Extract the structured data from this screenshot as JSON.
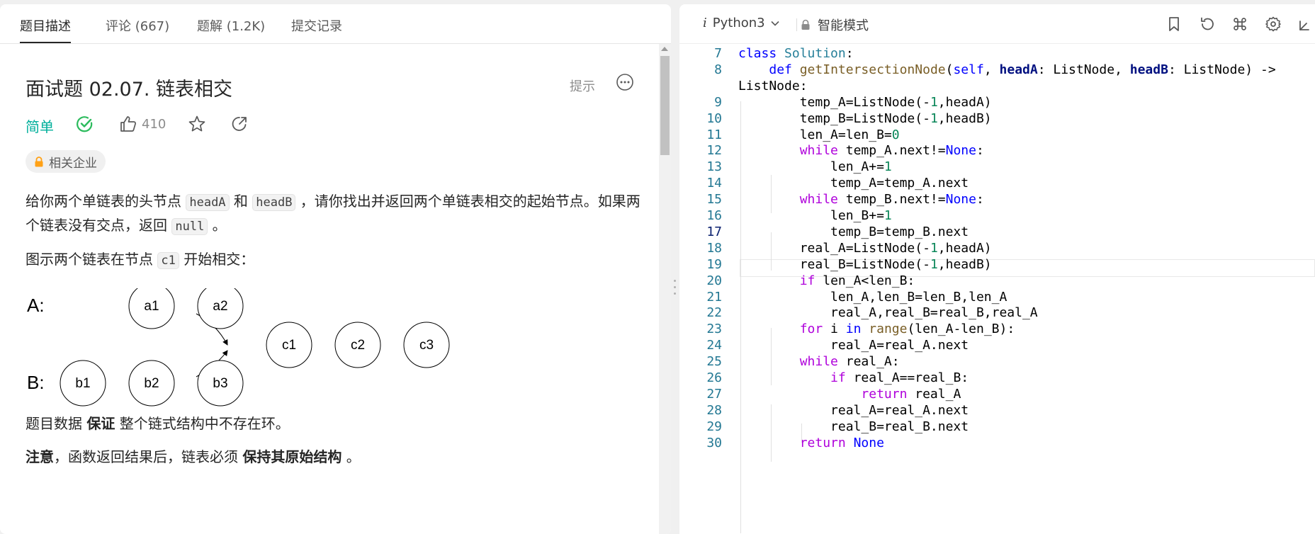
{
  "tabs": [
    {
      "label": "题目描述",
      "active": true
    },
    {
      "label": "评论 (667)"
    },
    {
      "label": "题解 (1.2K)"
    },
    {
      "label": "提交记录"
    }
  ],
  "problem": {
    "title": "面试题 02.07. 链表相交",
    "hint_label": "提示",
    "difficulty": "简单",
    "likes": "410",
    "company_tag": "相关企业",
    "para1_a": "给你两个单链表的头节点 ",
    "code_headA": "headA",
    "para1_b": " 和 ",
    "code_headB": "headB",
    "para1_c": " ，请你找出并返回两个单链表相交的起始节点。如果两个链表没有交点，返回 ",
    "code_null": "null",
    "para1_d": " 。",
    "para2_a": "图示两个链表在节点 ",
    "code_c1": "c1",
    "para2_b": " 开始相交：",
    "para3_a": "题目数据 ",
    "para3_bold": "保证",
    "para3_b": " 整个链式结构中不存在环。",
    "para4_bold1": "注意",
    "para4_a": "，函数返回结果后，链表必须 ",
    "para4_bold2": "保持其原始结构",
    "para4_b": " 。"
  },
  "diagram": {
    "label_a": "A:",
    "label_b": "B:",
    "nodes_a": [
      "a1",
      "a2"
    ],
    "nodes_b": [
      "b1",
      "b2",
      "b3"
    ],
    "nodes_c": [
      "c1",
      "c2",
      "c3"
    ]
  },
  "editor": {
    "language": "Python3",
    "language_prefix": "i",
    "mode": "智能模式",
    "current_line": 17,
    "colors": {
      "keyword": "#0000ff",
      "control": "#af00db",
      "class": "#267f99",
      "function": "#795e26",
      "number": "#098658"
    }
  },
  "code_lines": [
    {
      "n": "7",
      "text": "class Solution:"
    },
    {
      "n": "8",
      "text": "    def getIntersectionNode(self, headA: ListNode, headB: ListNode) ->"
    },
    {
      "n": "",
      "text": "ListNode:"
    },
    {
      "n": "9",
      "text": "        temp_A=ListNode(-1,headA)"
    },
    {
      "n": "10",
      "text": "        temp_B=ListNode(-1,headB)"
    },
    {
      "n": "11",
      "text": "        len_A=len_B=0"
    },
    {
      "n": "12",
      "text": "        while temp_A.next!=None:"
    },
    {
      "n": "13",
      "text": "            len_A+=1"
    },
    {
      "n": "14",
      "text": "            temp_A=temp_A.next"
    },
    {
      "n": "15",
      "text": "        while temp_B.next!=None:"
    },
    {
      "n": "16",
      "text": "            len_B+=1"
    },
    {
      "n": "17",
      "text": "            temp_B=temp_B.next"
    },
    {
      "n": "18",
      "text": "        real_A=ListNode(-1,headA)"
    },
    {
      "n": "19",
      "text": "        real_B=ListNode(-1,headB)"
    },
    {
      "n": "20",
      "text": "        if len_A<len_B:"
    },
    {
      "n": "21",
      "text": "            len_A,len_B=len_B,len_A"
    },
    {
      "n": "22",
      "text": "            real_A,real_B=real_B,real_A"
    },
    {
      "n": "23",
      "text": "        for i in range(len_A-len_B):"
    },
    {
      "n": "24",
      "text": "            real_A=real_A.next"
    },
    {
      "n": "25",
      "text": "        while real_A:"
    },
    {
      "n": "26",
      "text": "            if real_A==real_B:"
    },
    {
      "n": "27",
      "text": "                return real_A"
    },
    {
      "n": "28",
      "text": "            real_A=real_A.next"
    },
    {
      "n": "29",
      "text": "            real_B=real_B.next"
    },
    {
      "n": "30",
      "text": "        return None"
    }
  ]
}
